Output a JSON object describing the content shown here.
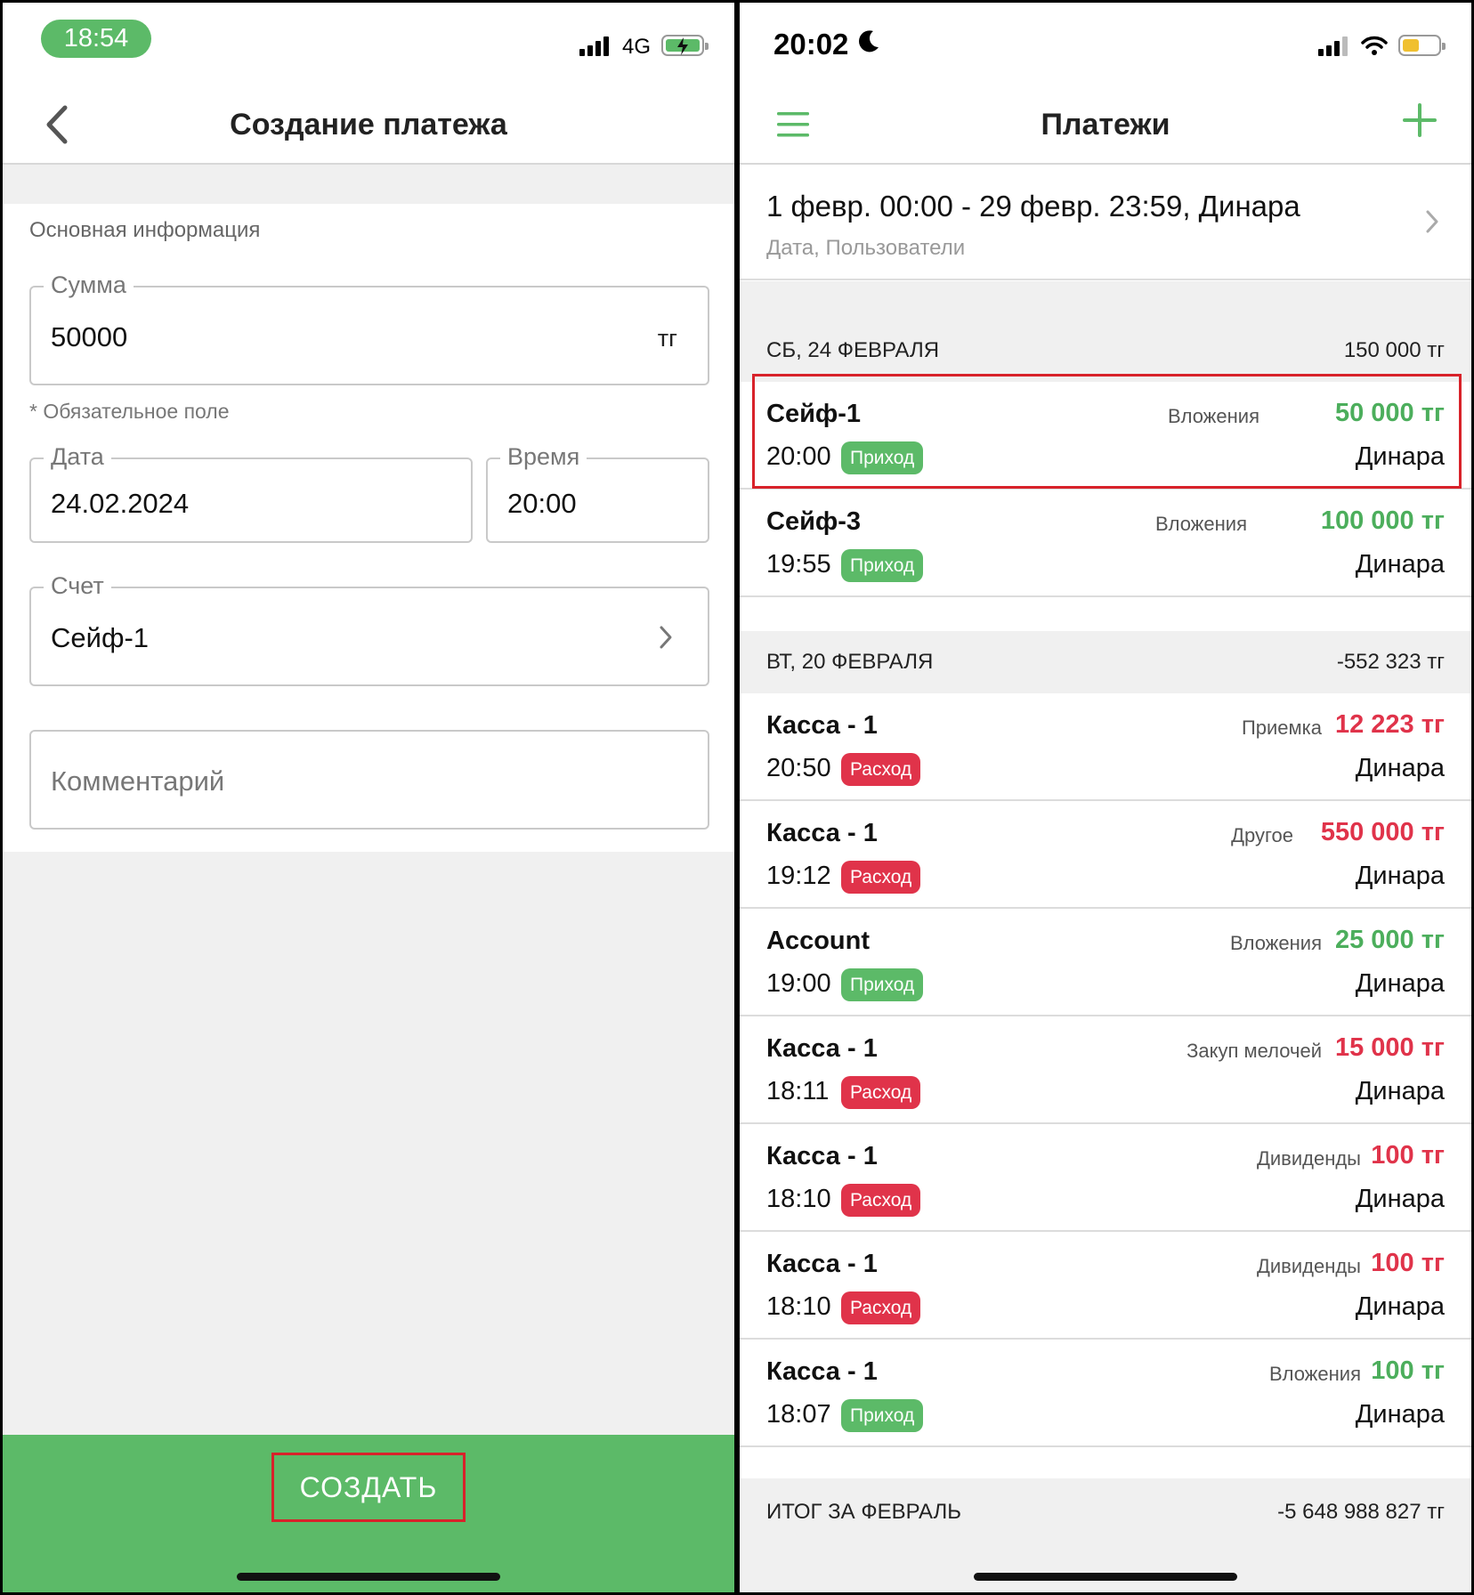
{
  "left": {
    "status": {
      "time": "18:54",
      "network": "4G"
    },
    "nav": {
      "title": "Создание платежа"
    },
    "section_title": "Основная информация",
    "amount": {
      "label": "Сумма",
      "value": "50000",
      "suffix": "тг"
    },
    "required_hint": "* Обязательное поле",
    "date": {
      "label": "Дата",
      "value": "24.02.2024"
    },
    "time": {
      "label": "Время",
      "value": "20:00"
    },
    "account": {
      "label": "Счет",
      "value": "Сейф-1"
    },
    "comment": {
      "placeholder": "Комментарий"
    },
    "create_label": "СОЗДАТЬ"
  },
  "right": {
    "status": {
      "time": "20:02"
    },
    "nav": {
      "title": "Платежи"
    },
    "filter": {
      "main": "1 февр. 00:00 - 29 февр. 23:59, Динара",
      "sub": "Дата, Пользователи"
    },
    "groups": [
      {
        "date": "СБ, 24 ФЕВРАЛЯ",
        "total": "150 000 тг",
        "items": [
          {
            "account": "Сейф-1",
            "time": "20:00",
            "type": "Приход",
            "category": "Вложения",
            "amount": "50 000 тг",
            "user": "Динара"
          },
          {
            "account": "Сейф-3",
            "time": "19:55",
            "type": "Приход",
            "category": "Вложения",
            "amount": "100 000 тг",
            "user": "Динара"
          }
        ]
      },
      {
        "date": "ВТ, 20 ФЕВРАЛЯ",
        "total": "-552 323 тг",
        "items": [
          {
            "account": "Касса - 1",
            "time": "20:50",
            "type": "Расход",
            "category": "Приемка",
            "amount": "12 223 тг",
            "user": "Динара"
          },
          {
            "account": "Касса - 1",
            "time": "19:12",
            "type": "Расход",
            "category": "Другое",
            "amount": "550 000 тг",
            "user": "Динара"
          },
          {
            "account": "Account",
            "time": "19:00",
            "type": "Приход",
            "category": "Вложения",
            "amount": "25 000 тг",
            "user": "Динара"
          },
          {
            "account": "Касса - 1",
            "time": "18:11",
            "type": "Расход",
            "category": "Закуп мелочей",
            "amount": "15 000 тг",
            "user": "Динара"
          },
          {
            "account": "Касса - 1",
            "time": "18:10",
            "type": "Расход",
            "category": "Дивиденды",
            "amount": "100 тг",
            "user": "Динара"
          },
          {
            "account": "Касса - 1",
            "time": "18:10",
            "type": "Расход",
            "category": "Дивиденды",
            "amount": "100 тг",
            "user": "Динара"
          },
          {
            "account": "Касса - 1",
            "time": "18:07",
            "type": "Приход",
            "category": "Вложения",
            "amount": "100 тг",
            "user": "Динара"
          }
        ]
      }
    ],
    "total": {
      "label": "ИТОГ ЗА ФЕВРАЛЬ",
      "value": "-5 648 988 827 тг"
    }
  },
  "colors": {
    "green": "#5cba68",
    "red": "#e0334a",
    "highlight": "#d8222a"
  },
  "icons": [
    "back-chevron-icon",
    "menu-icon",
    "plus-icon",
    "chevron-right-icon",
    "signal-icon",
    "wifi-icon",
    "battery-icon",
    "moon-icon"
  ]
}
